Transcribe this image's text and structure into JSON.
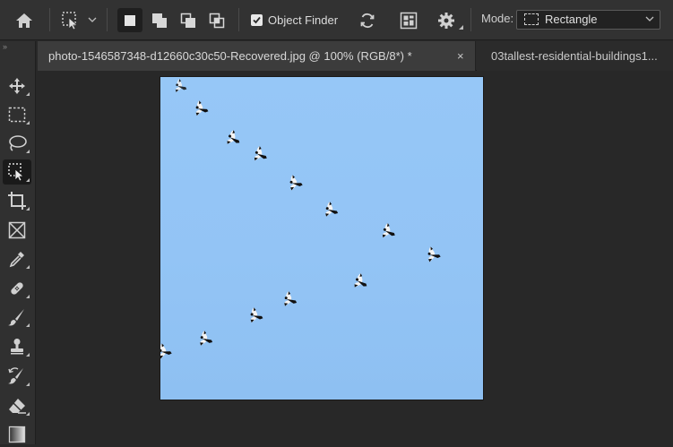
{
  "options_bar": {
    "object_finder_label": "Object Finder",
    "object_finder_checked": true,
    "mode_label": "Mode:",
    "mode_value": "Rectangle"
  },
  "tabs": [
    {
      "title": "photo-1546587348-d12660c30c50-Recovered.jpg @ 100% (RGB/8*) *",
      "close": "×",
      "active": true
    },
    {
      "title": "03tallest-residential-buildings1...",
      "active": false
    }
  ],
  "toolbar": {
    "grip": "»",
    "tools": [
      {
        "name": "move-tool",
        "icon": "move-icon",
        "selected": false
      },
      {
        "name": "rectangular-marquee-tool",
        "icon": "marquee-icon",
        "selected": false
      },
      {
        "name": "lasso-tool",
        "icon": "lasso-icon",
        "selected": false
      },
      {
        "name": "object-selection-tool",
        "icon": "object-selection-icon",
        "selected": true
      },
      {
        "name": "crop-tool",
        "icon": "crop-icon",
        "selected": false
      },
      {
        "name": "frame-tool",
        "icon": "frame-icon",
        "selected": false
      },
      {
        "name": "eyedropper-tool",
        "icon": "eyedropper-icon",
        "selected": false
      },
      {
        "name": "spot-healing-tool",
        "icon": "bandage-icon",
        "selected": false
      },
      {
        "name": "brush-tool",
        "icon": "brush-icon",
        "selected": false
      },
      {
        "name": "clone-stamp-tool",
        "icon": "stamp-icon",
        "selected": false
      },
      {
        "name": "history-brush-tool",
        "icon": "history-brush-icon",
        "selected": false
      },
      {
        "name": "eraser-tool",
        "icon": "eraser-icon",
        "selected": false
      },
      {
        "name": "gradient-tool",
        "icon": "gradient-icon",
        "selected": false
      }
    ]
  },
  "canvas": {
    "content": "image of a flock of birds flying in a V across a blue sky"
  },
  "colors": {
    "sky": "#93c4f5",
    "panel": "#323232",
    "background": "#282828"
  }
}
